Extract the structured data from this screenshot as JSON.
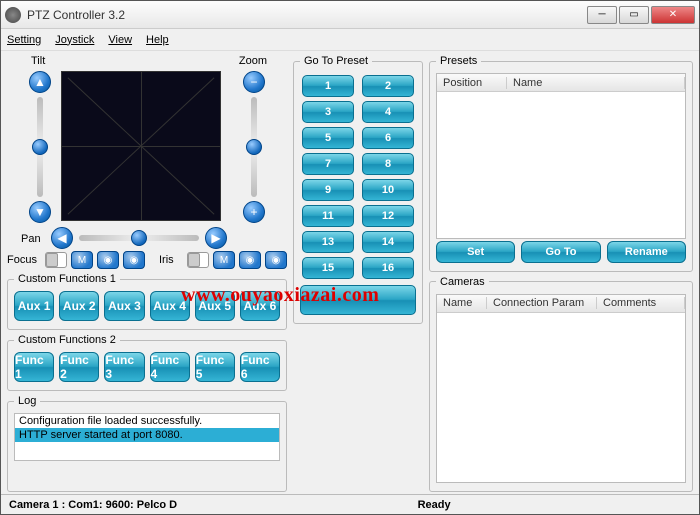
{
  "window": {
    "title": "PTZ Controller 3.2"
  },
  "menu": {
    "setting": "Setting",
    "joystick": "Joystick",
    "view": "View",
    "help": "Help"
  },
  "ptz": {
    "tilt": "Tilt",
    "zoom": "Zoom",
    "pan": "Pan",
    "focus": "Focus",
    "iris": "Iris",
    "m": "M"
  },
  "custom1": {
    "legend": "Custom Functions 1",
    "buttons": [
      "Aux 1",
      "Aux 2",
      "Aux 3",
      "Aux 4",
      "Aux 5",
      "Aux 6"
    ]
  },
  "custom2": {
    "legend": "Custom Functions 2",
    "buttons": [
      "Func 1",
      "Func 2",
      "Func 3",
      "Func 4",
      "Func 5",
      "Func 6"
    ]
  },
  "log": {
    "legend": "Log",
    "line1": "Configuration file loaded successfully.",
    "line2": "HTTP server started at port 8080."
  },
  "presets_go": {
    "legend": "Go To Preset",
    "nums": [
      "1",
      "2",
      "3",
      "4",
      "5",
      "6",
      "7",
      "8",
      "9",
      "10",
      "11",
      "12",
      "13",
      "14",
      "15",
      "16"
    ]
  },
  "presets": {
    "legend": "Presets",
    "col_pos": "Position",
    "col_name": "Name",
    "set": "Set",
    "goto": "Go To",
    "rename": "Rename"
  },
  "cameras": {
    "legend": "Cameras",
    "col_name": "Name",
    "col_conn": "Connection Param",
    "col_comm": "Comments"
  },
  "status": {
    "left": "Camera 1 : Com1: 9600: Pelco D",
    "right": "Ready"
  },
  "watermark": "www.ouyaoxiazai.com"
}
